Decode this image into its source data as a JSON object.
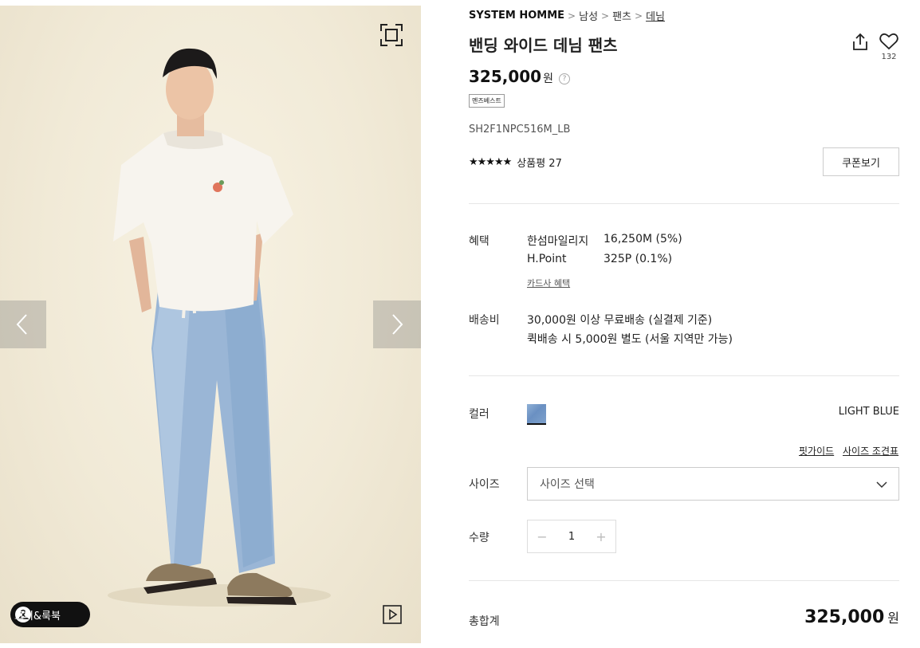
{
  "gallery": {
    "expand_icon": "expand-icon",
    "prev_icon": "chevron-left-icon",
    "next_icon": "chevron-right-icon",
    "codi_label": "코디&룩북",
    "video_icon": "video-play-icon"
  },
  "breadcrumb": {
    "brand": "SYSTEM HOMME",
    "items": [
      "남성",
      "팬츠",
      "데님"
    ]
  },
  "product": {
    "title": "밴딩 와이드 데님 팬츠",
    "like_count": "132",
    "price": "325,000",
    "currency": "원",
    "tag": "멘즈베스트",
    "sku": "SH2F1NPC516M_LB",
    "stars": "★★★★★",
    "review_label": "상품평 27",
    "coupon_button": "쿠폰보기"
  },
  "benefits": {
    "label": "혜택",
    "rows": [
      {
        "name": "한섬마일리지",
        "value": "16,250M (5%)"
      },
      {
        "name": "H.Point",
        "value": "325P (0.1%)"
      }
    ],
    "card_link": "카드사 혜택"
  },
  "shipping": {
    "label": "배송비",
    "line1": "30,000원 이상 무료배송 (실결제 기준)",
    "line2": "퀵배송 시 5,000원 별도 (서울 지역만 가능)"
  },
  "color": {
    "label": "컬러",
    "selected_name": "LIGHT BLUE",
    "swatch_color": "#7a9dcc"
  },
  "size": {
    "fit_guide": "핏가이드",
    "size_chart": "사이즈 조견표",
    "label": "사이즈",
    "placeholder": "사이즈 선택"
  },
  "quantity": {
    "label": "수량",
    "minus": "−",
    "value": "1",
    "plus": "+"
  },
  "total": {
    "label": "총합계",
    "amount": "325,000",
    "currency": "원"
  }
}
